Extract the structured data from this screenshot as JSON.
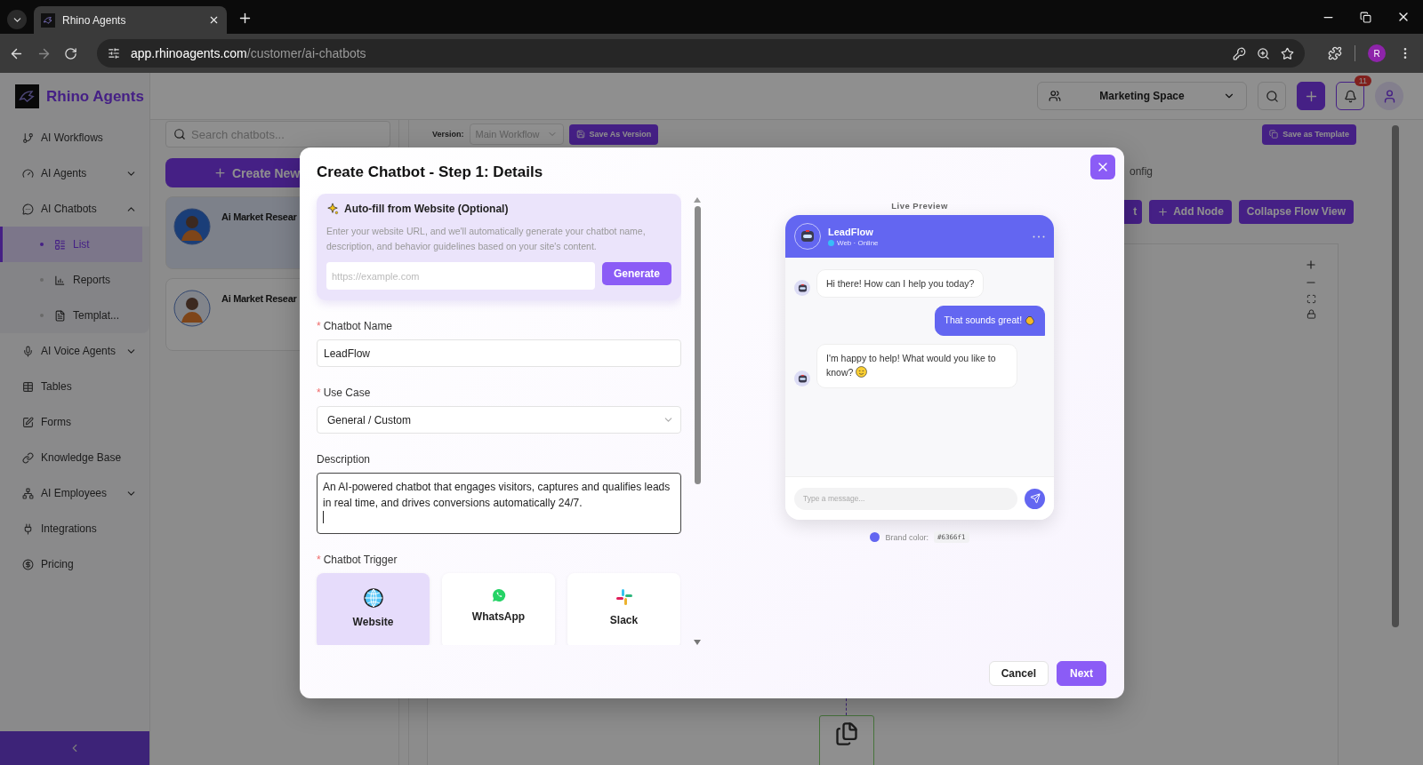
{
  "browser": {
    "tab_title": "Rhino Agents",
    "url_host": "app.rhinoagents.com",
    "url_path": "/customer/ai-chatbots",
    "profile_initial": "R"
  },
  "sidebar": {
    "brand": "Rhino Agents",
    "items": [
      {
        "label": "AI Workflows",
        "kind": "link"
      },
      {
        "label": "AI Agents",
        "kind": "group",
        "expanded": false
      },
      {
        "label": "AI Chatbots",
        "kind": "group",
        "expanded": true,
        "children": [
          {
            "label": "List",
            "selected": true
          },
          {
            "label": "Reports",
            "selected": false
          },
          {
            "label": "Templat...",
            "selected": false
          }
        ]
      },
      {
        "label": "AI Voice Agents",
        "kind": "group",
        "expanded": false
      },
      {
        "label": "Tables",
        "kind": "link"
      },
      {
        "label": "Forms",
        "kind": "link"
      },
      {
        "label": "Knowledge Base",
        "kind": "link"
      },
      {
        "label": "AI Employees",
        "kind": "group",
        "expanded": false
      },
      {
        "label": "Integrations",
        "kind": "link"
      },
      {
        "label": "Pricing",
        "kind": "link"
      }
    ]
  },
  "header": {
    "workspace": "Marketing Space",
    "notifications": "11"
  },
  "chatbot_list": {
    "search_placeholder": "Search chatbots...",
    "create_label": "Create New",
    "items": [
      {
        "name": "Ai Market Resear",
        "selected": true
      },
      {
        "name": "Ai Market Resear",
        "selected": false
      }
    ]
  },
  "workflow": {
    "version_label": "Version:",
    "version_value": "Main Workflow",
    "save_version": "Save As Version",
    "save_template": "Save as Template",
    "tab_fragment": "onfig",
    "buttons": [
      "t",
      "Add Node",
      "Collapse Flow View"
    ]
  },
  "modal": {
    "title": "Create Chatbot - Step 1: Details",
    "autofill": {
      "title": "Auto-fill from Website (Optional)",
      "description": "Enter your website URL, and we'll automatically generate your chatbot name, description, and behavior guidelines based on your site's content.",
      "placeholder": "https://example.com",
      "button": "Generate"
    },
    "fields": [
      {
        "kind": "text",
        "label": "Chatbot Name",
        "marker": "*",
        "value": "LeadFlow"
      },
      {
        "kind": "select",
        "label": "Use Case",
        "marker": "*",
        "value": "General / Custom"
      },
      {
        "kind": "textarea",
        "label": "Description",
        "value": "An AI-powered chatbot that engages visitors, captures and qualifies leads in real time, and drives conversions automatically 24/7."
      }
    ],
    "trigger": {
      "label": "Chatbot Trigger",
      "marker": "*",
      "options": [
        {
          "label": "Website",
          "selected": true
        },
        {
          "label": "WhatsApp",
          "selected": false
        },
        {
          "label": "Slack",
          "selected": false
        }
      ]
    },
    "preview": {
      "title": "Live Preview",
      "bot_name": "LeadFlow",
      "status": "Web · Online",
      "messages": [
        {
          "kind": "bot",
          "text": "Hi there! How can I help you today?"
        },
        {
          "kind": "user",
          "text": "That sounds great!"
        },
        {
          "kind": "bot",
          "text": "I'm happy to help! What would you like to know?"
        }
      ],
      "input_placeholder": "Type a message...",
      "brand_label": "Brand color:",
      "brand_code": "#6366f1"
    },
    "actions": [
      "Cancel",
      "Next"
    ]
  }
}
